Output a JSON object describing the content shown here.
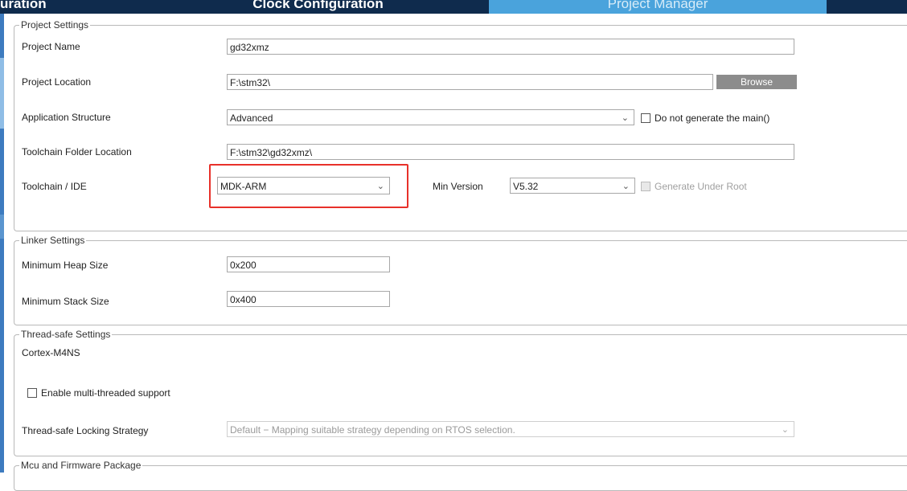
{
  "tabs": [
    {
      "label": "uration"
    },
    {
      "label": "Clock Configuration"
    },
    {
      "label": "Project Manager"
    },
    {
      "label": ""
    }
  ],
  "project_settings": {
    "legend": "Project Settings",
    "project_name_label": "Project Name",
    "project_name_value": "gd32xmz",
    "project_location_label": "Project Location",
    "project_location_value": "F:\\stm32\\",
    "browse_label": "Browse",
    "app_structure_label": "Application Structure",
    "app_structure_value": "Advanced",
    "no_main_label": "Do not generate the main()",
    "toolchain_folder_label": "Toolchain Folder Location",
    "toolchain_folder_value": "F:\\stm32\\gd32xmz\\",
    "toolchain_ide_label": "Toolchain / IDE",
    "toolchain_ide_value": "MDK-ARM",
    "min_version_label": "Min Version",
    "min_version_value": "V5.32",
    "generate_under_root_label": "Generate Under Root"
  },
  "linker_settings": {
    "legend": "Linker Settings",
    "heap_label": "Minimum Heap Size",
    "heap_value": "0x200",
    "stack_label": "Minimum Stack Size",
    "stack_value": "0x400"
  },
  "thread_safe_settings": {
    "legend": "Thread-safe Settings",
    "core_label": "Cortex-M4NS",
    "multithread_label": "Enable multi-threaded support",
    "locking_label": "Thread-safe Locking Strategy",
    "locking_value": "Default  −  Mapping suitable strategy depending on RTOS selection."
  },
  "mcu_package": {
    "legend": "Mcu and Firmware Package"
  },
  "icons": {
    "chevron": "chevron-down-icon",
    "checkbox": "checkbox-icon"
  },
  "colors": {
    "tab_dark": "#0f2b4d",
    "tab_active": "#4aa3dc",
    "highlight": "#e8312a"
  }
}
